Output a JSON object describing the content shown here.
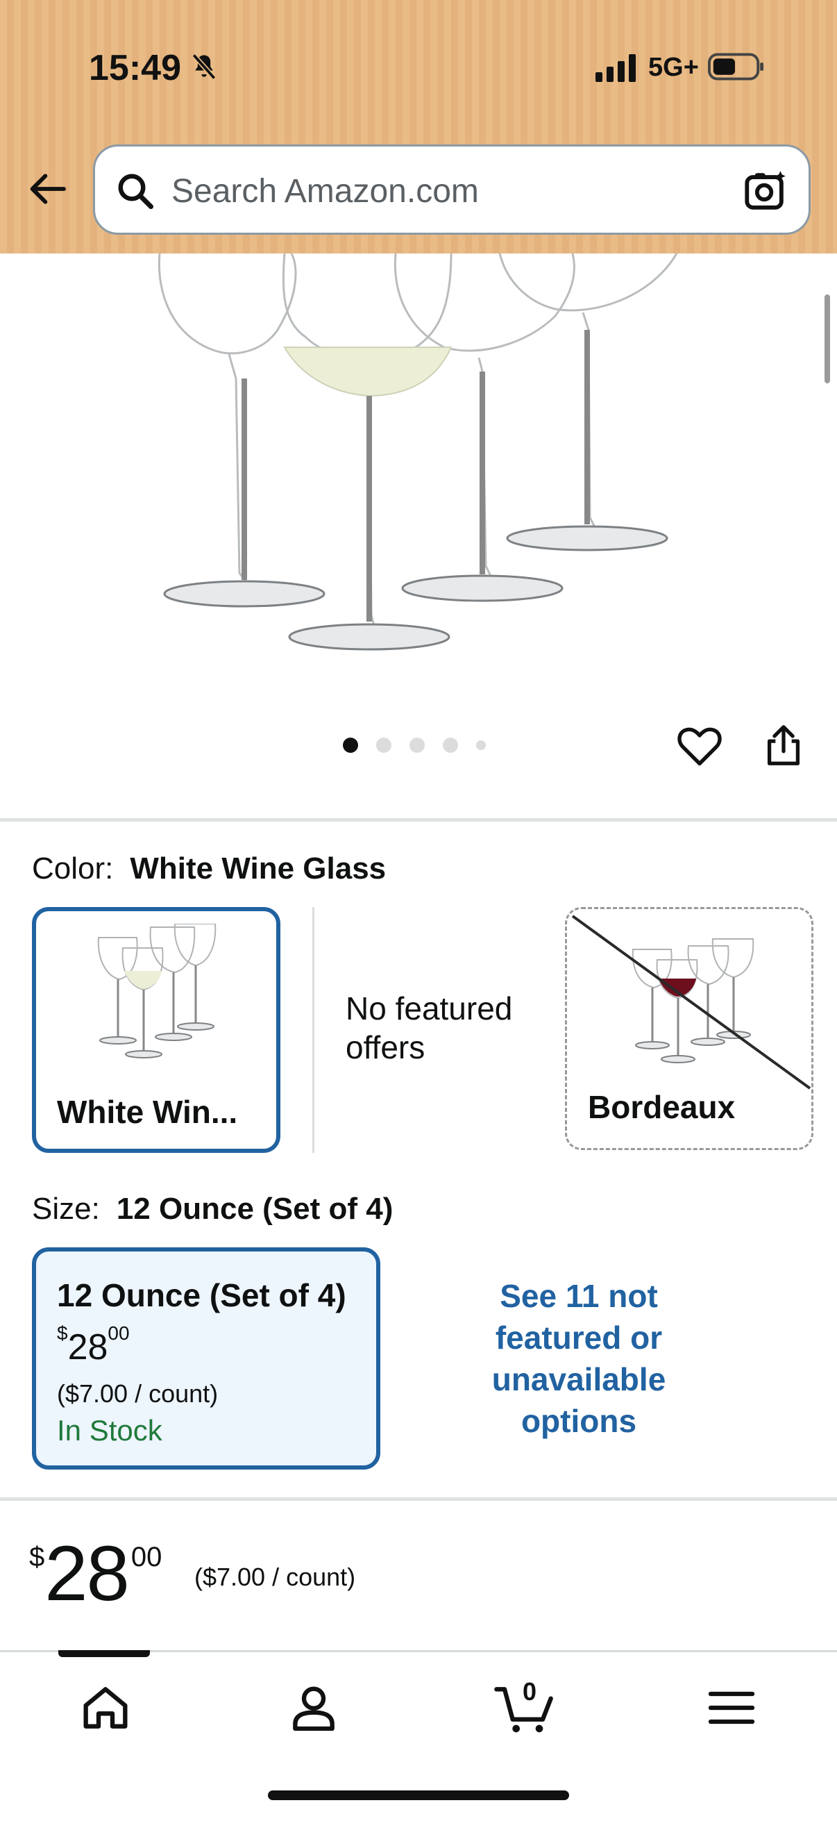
{
  "status_bar": {
    "time": "15:49",
    "network": "5G+",
    "icons": [
      "bell-slash-icon",
      "signal-icon",
      "battery-icon"
    ]
  },
  "header": {
    "search_placeholder": "Search Amazon.com",
    "icons": [
      "back-arrow-icon",
      "search-icon",
      "camera-icon"
    ],
    "colors": {
      "header_bg": "#e9bb86",
      "search_border": "#8b9aa5"
    }
  },
  "gallery": {
    "image_count": 5,
    "active_index": 0,
    "icons": [
      "heart-icon",
      "share-icon"
    ]
  },
  "color_selector": {
    "label": "Color:",
    "selected_value": "White Wine Glass",
    "options": [
      {
        "name": "White Win...",
        "state": "selected"
      },
      {
        "name": "No featured offers",
        "state": "info"
      },
      {
        "name": "Bordeaux",
        "state": "unavailable"
      }
    ]
  },
  "size_selector": {
    "label": "Size:",
    "selected_value": "12 Ounce (Set of 4)",
    "selected_option": {
      "title": "12 Ounce (Set of 4)",
      "price_currency": "$",
      "price_whole": "28",
      "price_fraction": "00",
      "unit_price": "($7.00 / count)",
      "stock": "In Stock"
    },
    "more_options_link": "See 11 not featured or unavailable options"
  },
  "price": {
    "currency": "$",
    "whole": "28",
    "fraction": "00",
    "unit_price": "($7.00 / count)"
  },
  "bottom_nav": {
    "items": [
      "home-icon",
      "account-icon",
      "cart-icon",
      "menu-icon"
    ],
    "cart_count": "0",
    "active": "home"
  },
  "colors": {
    "link_blue": "#2162a1",
    "in_stock_green": "#1f7a3a",
    "selected_bg": "#edf5fd"
  }
}
